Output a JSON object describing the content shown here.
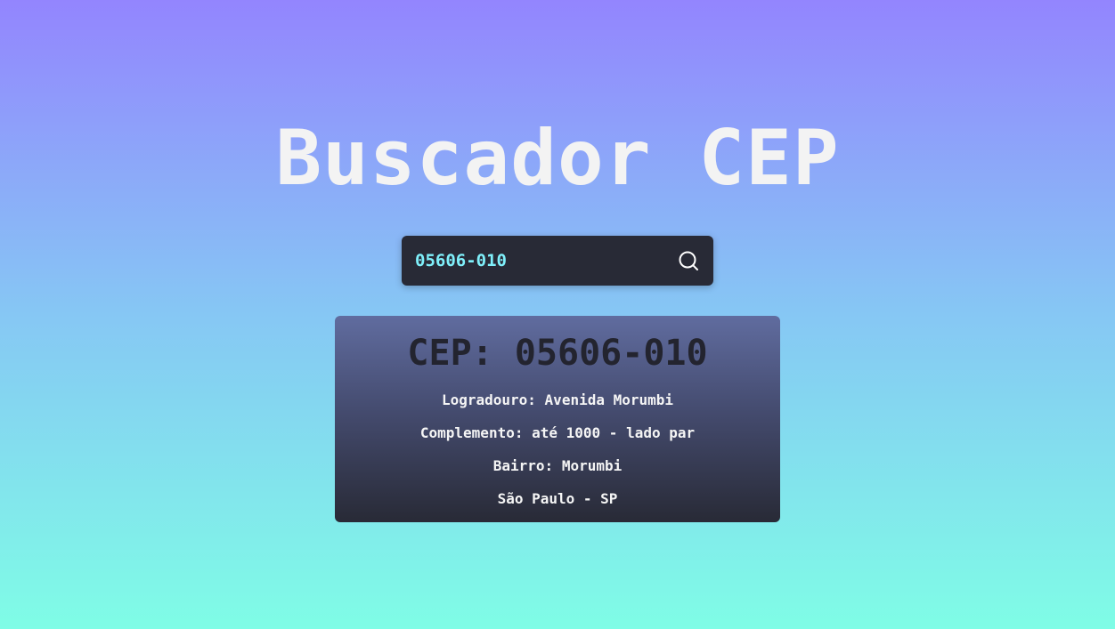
{
  "header": {
    "title": "Buscador CEP"
  },
  "search": {
    "value": "05606-010",
    "icon": "search-icon"
  },
  "result": {
    "title": "CEP: 05606-010",
    "logradouro": "Logradouro: Avenida Morumbi",
    "complemento": "Complemento: até 1000 - lado par",
    "bairro": "Bairro: Morumbi",
    "cidade_uf": "São Paulo - SP"
  },
  "colors": {
    "input_bg": "#282a36",
    "input_text": "#7ff0fb",
    "title_text": "#f3f3f3",
    "gradient_top": "#9385fe",
    "gradient_bottom": "#7ffde6"
  }
}
